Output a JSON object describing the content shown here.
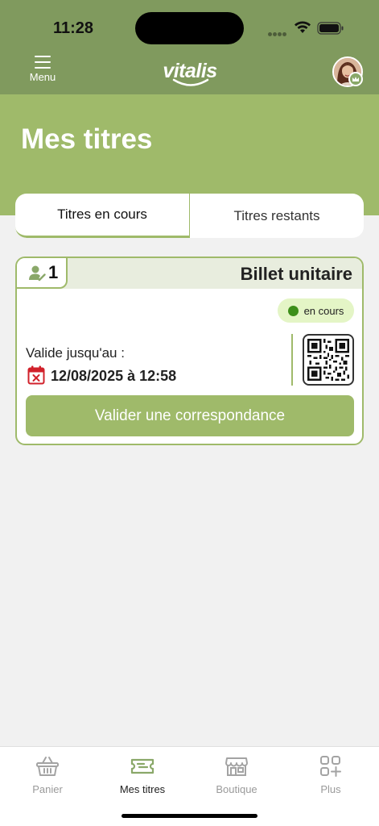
{
  "status_bar": {
    "time": "11:28"
  },
  "header": {
    "menu_label": "Menu",
    "logo_text": "vitalis"
  },
  "page": {
    "title": "Mes titres"
  },
  "tabs": [
    {
      "label": "Titres en cours",
      "active": true
    },
    {
      "label": "Titres restants",
      "active": false
    }
  ],
  "ticket": {
    "passenger_count": "1",
    "name": "Billet unitaire",
    "status": "en cours",
    "validity_label": "Valide jusqu'au :",
    "validity_date": "12/08/2025 à 12:58",
    "validate_button": "Valider une correspondance"
  },
  "bottom_nav": [
    {
      "label": "Panier",
      "icon": "basket-icon"
    },
    {
      "label": "Mes titres",
      "icon": "ticket-icon",
      "active": true
    },
    {
      "label": "Boutique",
      "icon": "shop-icon"
    },
    {
      "label": "Plus",
      "icon": "plus-grid-icon"
    }
  ],
  "colors": {
    "header": "#809a5e",
    "accent": "#9fba6a",
    "status_dot": "#3d8f1a",
    "calendar_red": "#d1212b"
  }
}
